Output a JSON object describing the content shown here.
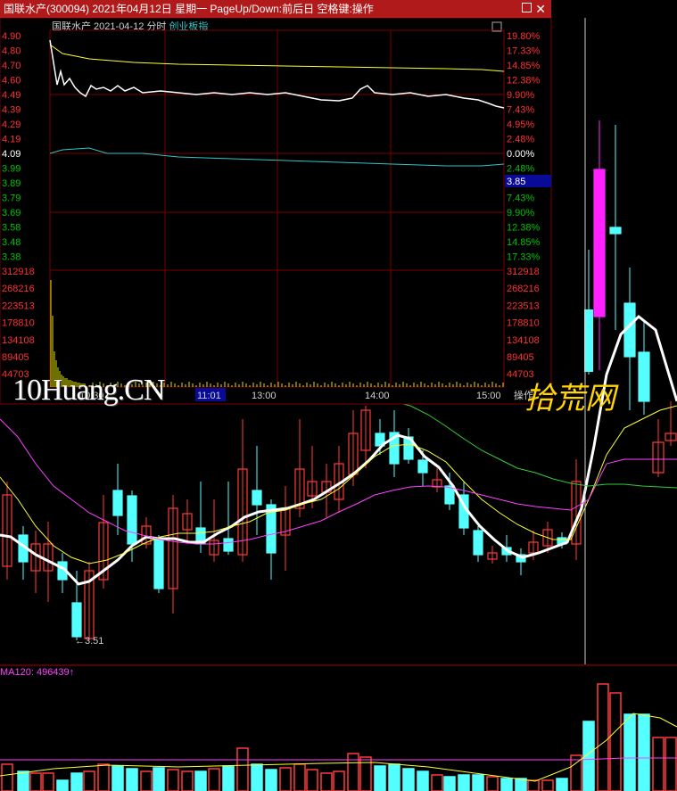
{
  "window": {
    "title": "国联水产(300094) 2021年04月12日 星期一 PageUp/Down:前后日 空格键:操作",
    "restore_label": "□",
    "close_label": "✕"
  },
  "intraday": {
    "header_name": "国联水产",
    "header_date": "2021-04-12",
    "header_mode": "分时",
    "header_link": "创业板指",
    "price_ticks": [
      "4.90",
      "4.80",
      "4.70",
      "4.60",
      "4.49",
      "4.39",
      "4.29",
      "4.19",
      "4.09",
      "3.99",
      "3.89",
      "3.79",
      "3.69",
      "3.58",
      "3.48",
      "3.38"
    ],
    "pct_ticks": [
      "19.80%",
      "17.33%",
      "14.85%",
      "12.38%",
      "9.90%",
      "7.43%",
      "4.95%",
      "2.48%",
      "0.00%",
      "2.48%",
      "4.95%",
      "7.43%",
      "9.90%",
      "12.38%",
      "14.85%",
      "17.33%"
    ],
    "current_price_tag": "3.85",
    "volume_ticks": [
      "312918",
      "268216",
      "223513",
      "178810",
      "134108",
      "89405",
      "44703"
    ],
    "time_ticks": [
      "10:30",
      "11:01",
      "13:00",
      "14:00",
      "15:00"
    ],
    "operate_label": "操作",
    "colors": {
      "up": "#ff3030",
      "down": "#00c000",
      "grid": "#7a0000",
      "price_line": "#ffffff",
      "avg_line": "#ffff33",
      "index_line": "#2ec6c6",
      "volume": "#e0e000"
    }
  },
  "kline": {
    "low_marker": "3.51",
    "ma_label": "MA120: 496439",
    "colors": {
      "up": "#ff3b3b",
      "down": "#54ffff",
      "ma5": "#ffffff",
      "ma10": "#ffff33",
      "ma20": "#ff40ff",
      "ma60": "#33cc33"
    }
  },
  "watermark": {
    "text": "10Huang.CN",
    "stamp": "拾荒网"
  }
}
